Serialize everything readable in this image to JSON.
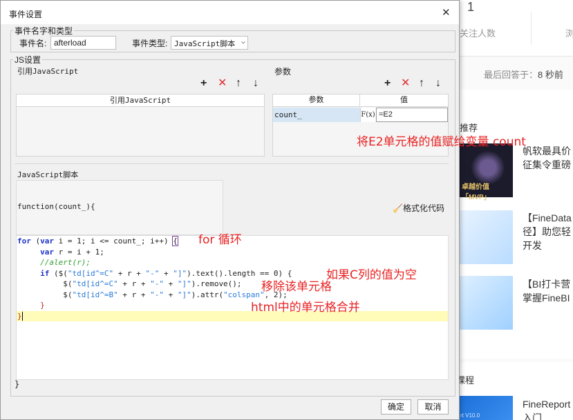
{
  "background": {
    "count_number": "1",
    "followers_label": "关注人数",
    "browse_label": "浏",
    "last_reply_label": "最后回答于：",
    "last_reply_value": "8 秒前",
    "recommend_heading": "推荐",
    "thumb1_text": "卓越价值「MVP」",
    "article1_line1": "帆软最具价",
    "article1_line2": "征集令重磅",
    "article2_line1": "【FineData",
    "article2_line2": "径】助您轻",
    "article2_line3": "开发",
    "article3_line1": "【BI打卡营",
    "article3_line2": "掌握FineBI",
    "course_heading": "课程",
    "course_article_line1": "FineReport",
    "course_article_line2": "入门",
    "thumb4_text": "rt V10.0"
  },
  "dialog": {
    "title": "事件设置",
    "event_group": "事件名字和类型",
    "event_name_label": "事件名:",
    "event_name_value": "afterload",
    "event_type_label": "事件类型:",
    "event_type_value": "JavaScript脚本",
    "js_group": "JS设置",
    "ref_js_label": "引用JavaScript",
    "ref_js_col": "引用JavaScript",
    "params_label": "参数",
    "params_col_param": "参数",
    "params_col_value": "值",
    "param_row": {
      "name": "count_",
      "formula_icon": "F(x)",
      "value": "=E2"
    },
    "script_label": "JavaScript脚本",
    "function_header": "function(count_){",
    "format_code_label": "格式化代码",
    "closing_brace": "}",
    "ok_label": "确定",
    "cancel_label": "取消"
  },
  "code": {
    "l1_kw": "for",
    "l1_a": " (",
    "l1_var": "var",
    "l1_b": " i = 1; i <= count_; i++) ",
    "l1_brace": "{",
    "l2_kw": "var",
    "l2_b": " r = i + 1;",
    "l3_cm": "//alert(r);",
    "l4_if": "if",
    "l4_a": " ($(",
    "l4_s1": "\"td[id^=C\"",
    "l4_b": " + r + ",
    "l4_s2": "\"-\"",
    "l4_c": " + ",
    "l4_s3": "\"]\"",
    "l4_d": ").text().length == 0) {",
    "l5_a": "$(",
    "l5_s1": "\"td[id^=C\"",
    "l5_b": " + r + ",
    "l5_s2": "\"-\"",
    "l5_c": " + ",
    "l5_s3": "\"]\"",
    "l5_d": ").remove();",
    "l6_a": "$(",
    "l6_s1": "\"td[id^=B\"",
    "l6_b": " + r + ",
    "l6_s2": "\"-\"",
    "l6_c": " + ",
    "l6_s3": "\"]\"",
    "l6_d": ").attr(",
    "l6_s4": "\"colspan\"",
    "l6_e": ", 2);",
    "l7": "}",
    "l8": "}"
  },
  "annotations": {
    "assign": "将E2单元格的值赋给变量 count",
    "for_loop": "for 循环",
    "if_empty": "如果C列的值为空",
    "remove": "移除该单元格",
    "merge": "html中的单元格合并"
  },
  "colors": {
    "annotation": "#e82222",
    "delete_icon": "#e03030",
    "line_highlight": "#fffbb8",
    "selected_param_row": "#d6e6f5"
  }
}
